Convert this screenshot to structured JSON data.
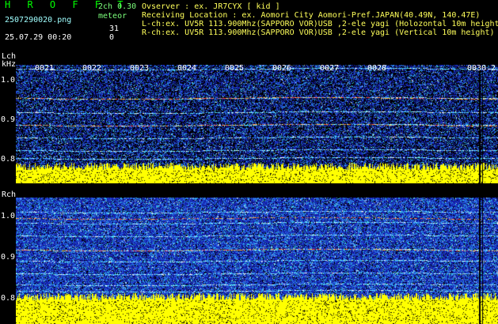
{
  "header": {
    "app_title": "H R O F F T",
    "version": "2ch 0.30",
    "detection_type": "meteor",
    "filename": "2507290020.png",
    "datetime": "25.07.29 00:20",
    "lch_count": "31",
    "rch_count": "0"
  },
  "info": [
    "Ovserver              : ex. JR7CYX [ kid ]",
    "Receiving Location : ex. Aomori City Aomori-Pref.JAPAN(40.49N, 140.47E)",
    "L-ch:ex. UV5R 113.900Mhz(SAPPORO VOR)USB ,2-ele yagi (Holozontal 10m height)",
    "R-ch:ex. UV5R 113.900Mhz(SAPPORO VOR)USB ,2-ele yagi (Vertical 10m height)"
  ],
  "lch": {
    "label": "Lch",
    "unit": "kHz",
    "yticks": [
      "1.0",
      "0.9",
      "0.8"
    ],
    "xticks": [
      "0021",
      "0022",
      "0023",
      "0024",
      "0025",
      "0026",
      "0027",
      "0028",
      "0030",
      "2"
    ]
  },
  "rch": {
    "label": "Rch",
    "yticks": [
      "1.0",
      "0.9",
      "0.8"
    ]
  },
  "colors": {
    "background": "#000000",
    "noise_blue": "#1a2aa8",
    "noise_cyan": "#37c7e6",
    "level_yellow": "#ffff00",
    "title_green": "#00ff00"
  }
}
